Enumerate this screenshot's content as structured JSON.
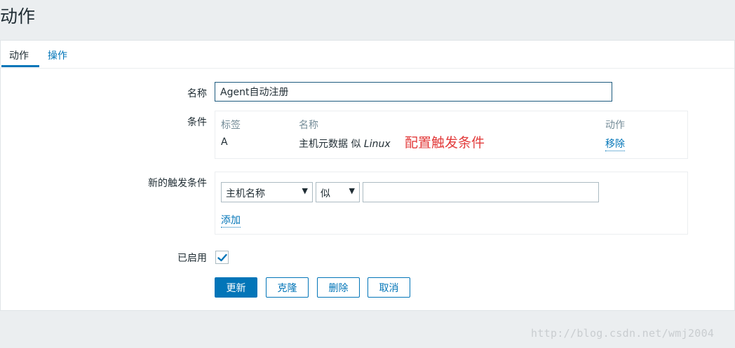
{
  "page": {
    "title": "动作"
  },
  "tabs": [
    {
      "label": "动作",
      "active": true
    },
    {
      "label": "操作",
      "active": false
    }
  ],
  "form": {
    "name_label": "名称",
    "name_value": "Agent自动注册",
    "conditions_label": "条件",
    "conditions": {
      "headers": {
        "label": "标签",
        "name": "名称",
        "action": "动作"
      },
      "rows": [
        {
          "label": "A",
          "name_prefix": "主机元数据 似 ",
          "name_value": "Linux",
          "action": "移除"
        }
      ]
    },
    "annotation": "配置触发条件",
    "new_condition_label": "新的触发条件",
    "new_condition": {
      "type_selected": "主机名称",
      "operator_selected": "似",
      "value": "",
      "add_label": "添加"
    },
    "enabled_label": "已启用",
    "enabled": true
  },
  "buttons": {
    "update": "更新",
    "clone": "克隆",
    "delete": "删除",
    "cancel": "取消"
  },
  "watermark": "http://blog.csdn.net/wmj2004",
  "colors": {
    "accent": "#0275b8",
    "annotation": "#e23b3b",
    "background": "#ebeef0"
  }
}
